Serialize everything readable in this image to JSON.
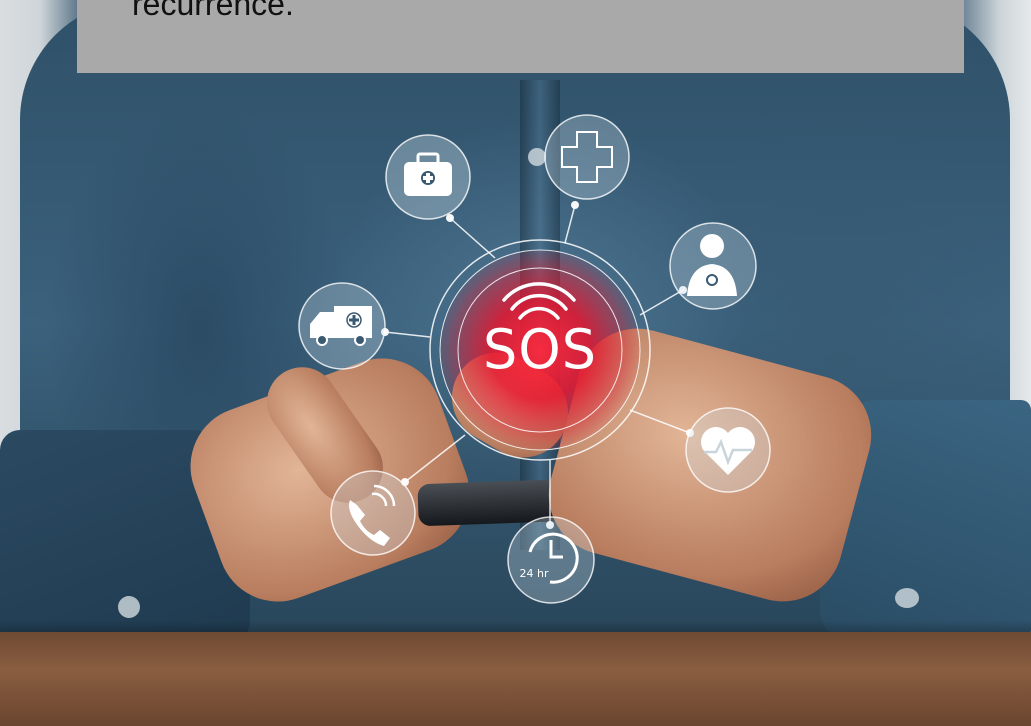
{
  "caption": {
    "text": "recurrence."
  },
  "hologram": {
    "center_label": "SOS",
    "clock_label": "24 hr",
    "icons": [
      "first-aid-kit-icon",
      "medical-cross-icon",
      "doctor-icon",
      "ambulance-icon",
      "heart-rate-icon",
      "phone-call-icon",
      "24-hour-clock-icon"
    ]
  },
  "colors": {
    "caption_background": "#a9a9a9",
    "sos_red": "#e8202f",
    "shirt_blue": "#35556d"
  }
}
